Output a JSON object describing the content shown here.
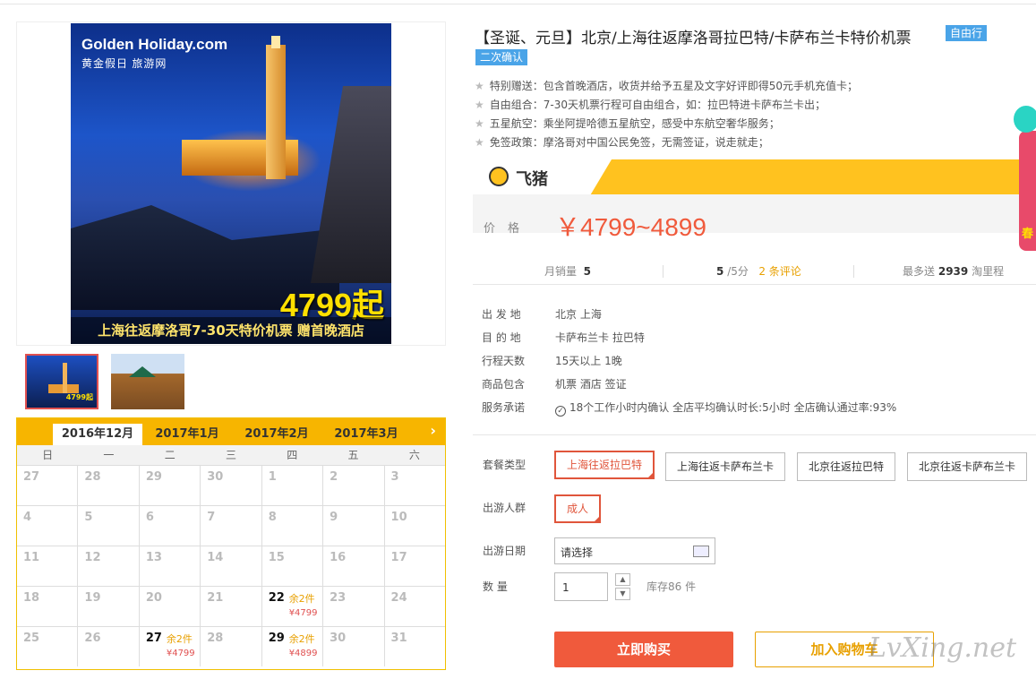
{
  "product": {
    "title": "【圣诞、元旦】北京/上海往返摩洛哥拉巴特/卡萨布兰卡特价机票",
    "badge_type": "自由行",
    "badge_confirm": "二次确认",
    "features": [
      "特别赠送：包含首晚酒店，收货并给予五星及文字好评即得50元手机充值卡；",
      "自由组合：7-30天机票行程可自由组合，如：拉巴特进卡萨布兰卡出；",
      "五星航空：乘坐阿提哈德五星航空，感受中东航空奢华服务；",
      "免签政策：摩洛哥对中国公民免签，无需签证，说走就走；"
    ]
  },
  "image": {
    "logo_en": "Golden Holiday.com",
    "logo_cn": "黄金假日 旅游网",
    "price_overlay": "4799起",
    "caption": "上海往返摩洛哥7-30天特价机票 赠首晚酒店",
    "thumb_price": "4799起"
  },
  "price": {
    "brand": "飞猪",
    "label": "价格",
    "value": "￥4799~4899"
  },
  "stats": {
    "monthly_label": "月销量",
    "monthly_value": "5",
    "rating_value": "5",
    "rating_suffix": "/5分",
    "reviews": "2 条评论",
    "miles_prefix": "最多送",
    "miles_value": "2939",
    "miles_suffix": "淘里程"
  },
  "info": [
    {
      "key": "出 发 地",
      "value": "北京  上海"
    },
    {
      "key": "目 的 地",
      "value": "卡萨布兰卡  拉巴特"
    },
    {
      "key": "行程天数",
      "value": "15天以上 1晚"
    },
    {
      "key": "商品包含",
      "value": "机票  酒店  签证"
    },
    {
      "key": "服务承诺",
      "value": "18个工作小时内确认    全店平均确认时长:5小时    全店确认通过率:93%"
    }
  ],
  "options": {
    "package_label": "套餐类型",
    "packages": [
      "上海往返拉巴特",
      "上海往返卡萨布兰卡",
      "北京往返拉巴特",
      "北京往返卡萨布兰卡"
    ],
    "group_label": "出游人群",
    "group": "成人",
    "date_label": "出游日期",
    "date_placeholder": "请选择",
    "qty_label": "数    量",
    "qty_value": "1",
    "stock": "库存86 件"
  },
  "buttons": {
    "buy": "立即购买",
    "cart": "加入购物车"
  },
  "watermark": "LvXing.net",
  "calendar": {
    "months": [
      "2016年12月",
      "2017年1月",
      "2017年2月",
      "2017年3月"
    ],
    "next": "›",
    "weekdays": [
      "日",
      "一",
      "二",
      "三",
      "四",
      "五",
      "六"
    ],
    "weeks": [
      [
        {
          "d": "27"
        },
        {
          "d": "28"
        },
        {
          "d": "29"
        },
        {
          "d": "30"
        },
        {
          "d": "1"
        },
        {
          "d": "2"
        },
        {
          "d": "3"
        }
      ],
      [
        {
          "d": "4"
        },
        {
          "d": "5"
        },
        {
          "d": "6"
        },
        {
          "d": "7"
        },
        {
          "d": "8"
        },
        {
          "d": "9"
        },
        {
          "d": "10"
        }
      ],
      [
        {
          "d": "11"
        },
        {
          "d": "12"
        },
        {
          "d": "13"
        },
        {
          "d": "14"
        },
        {
          "d": "15"
        },
        {
          "d": "16"
        },
        {
          "d": "17"
        }
      ],
      [
        {
          "d": "18"
        },
        {
          "d": "19"
        },
        {
          "d": "20"
        },
        {
          "d": "21"
        },
        {
          "d": "22",
          "rem": "余2件",
          "price": "¥4799"
        },
        {
          "d": "23"
        },
        {
          "d": "24"
        }
      ],
      [
        {
          "d": "25"
        },
        {
          "d": "26"
        },
        {
          "d": "27",
          "rem": "余2件",
          "price": "¥4799"
        },
        {
          "d": "28"
        },
        {
          "d": "29",
          "rem": "余2件",
          "price": "¥4899"
        },
        {
          "d": "30"
        },
        {
          "d": "31"
        }
      ]
    ]
  },
  "colors": {
    "accent": "#f05a3c",
    "calendar_header": "#f7b500",
    "badge": "#4aa4e8"
  }
}
